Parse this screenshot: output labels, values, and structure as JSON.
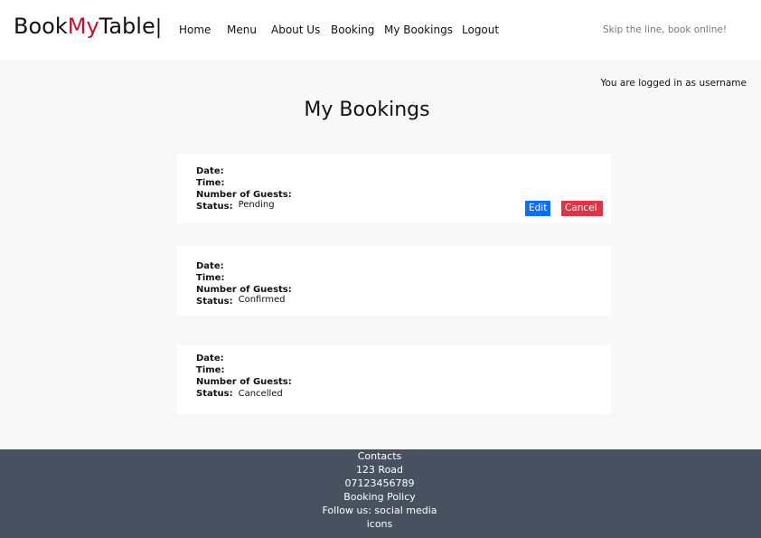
{
  "navbar": {
    "brand": {
      "part1": "Book",
      "part2": "My",
      "part3": "Table",
      "cursor": "|"
    },
    "links": [
      "Home",
      "Menu",
      "About Us",
      "Booking",
      "My Bookings",
      "Logout"
    ],
    "tagline": "Skip the line, book online!"
  },
  "login_status": "You are logged in as username",
  "page_title": "My Bookings",
  "labels": {
    "date": "Date:",
    "time": "Time:",
    "guests": "Number of Guests:",
    "status": "Status:"
  },
  "bookings": [
    {
      "date": "",
      "time": "",
      "guests": "",
      "status": "Pending",
      "edit_label": "Edit",
      "cancel_label": "Cancel"
    },
    {
      "date": "",
      "time": "",
      "guests": "",
      "status": "Confirmed"
    },
    {
      "date": "",
      "time": "",
      "guests": "",
      "status": "Cancelled"
    }
  ],
  "footer": {
    "contacts": "Contacts",
    "address": "123 Road",
    "phone": "07123456789",
    "policy": "Booking Policy",
    "follow": "Follow us: social media icons"
  },
  "colors": {
    "brand_accent": "#c8102e",
    "edit_button": "#0d6efd",
    "cancel_button": "#dc3545",
    "footer_bg": "#475160"
  }
}
